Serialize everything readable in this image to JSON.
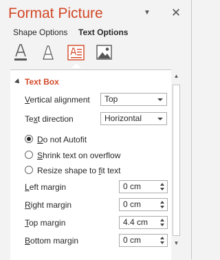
{
  "pane": {
    "title": "Format Picture",
    "menu_icon": "dropdown-triangle-icon",
    "close_icon": "close-icon",
    "close_glyph": "✕",
    "menu_glyph": "▼"
  },
  "tabs": {
    "shape_options": "Shape Options",
    "text_options": "Text Options"
  },
  "icons": [
    "text-fill-outline-icon",
    "text-effects-icon",
    "textbox-icon",
    "picture-icon"
  ],
  "text_box": {
    "header": "Text Box",
    "vertical_alignment": {
      "label_pre": "V",
      "label_u": "",
      "label_rest": "ertical alignment",
      "value": "Top"
    },
    "text_direction": {
      "label_pre": "Te",
      "label_u": "x",
      "label_rest": "t direction",
      "value": "Horizontal"
    },
    "autofit": [
      {
        "pre": "",
        "u": "D",
        "rest": "o not Autofit",
        "checked": true
      },
      {
        "pre": "",
        "u": "S",
        "rest": "hrink text on overflow",
        "checked": false
      },
      {
        "pre": "Resize shape to ",
        "u": "f",
        "rest": "it text",
        "checked": false
      }
    ],
    "margins": [
      {
        "pre": "",
        "u": "L",
        "rest": "eft margin",
        "value": "0 cm"
      },
      {
        "pre": "",
        "u": "R",
        "rest": "ight margin",
        "value": "0 cm"
      },
      {
        "pre": "",
        "u": "T",
        "rest": "op margin",
        "value": "4.4 cm"
      },
      {
        "pre": "",
        "u": "B",
        "rest": "ottom margin",
        "value": "0 cm"
      }
    ]
  },
  "colors": {
    "accent": "#d24726",
    "pane_bg": "#f3f3f3",
    "panel_bg": "#ffffff"
  }
}
